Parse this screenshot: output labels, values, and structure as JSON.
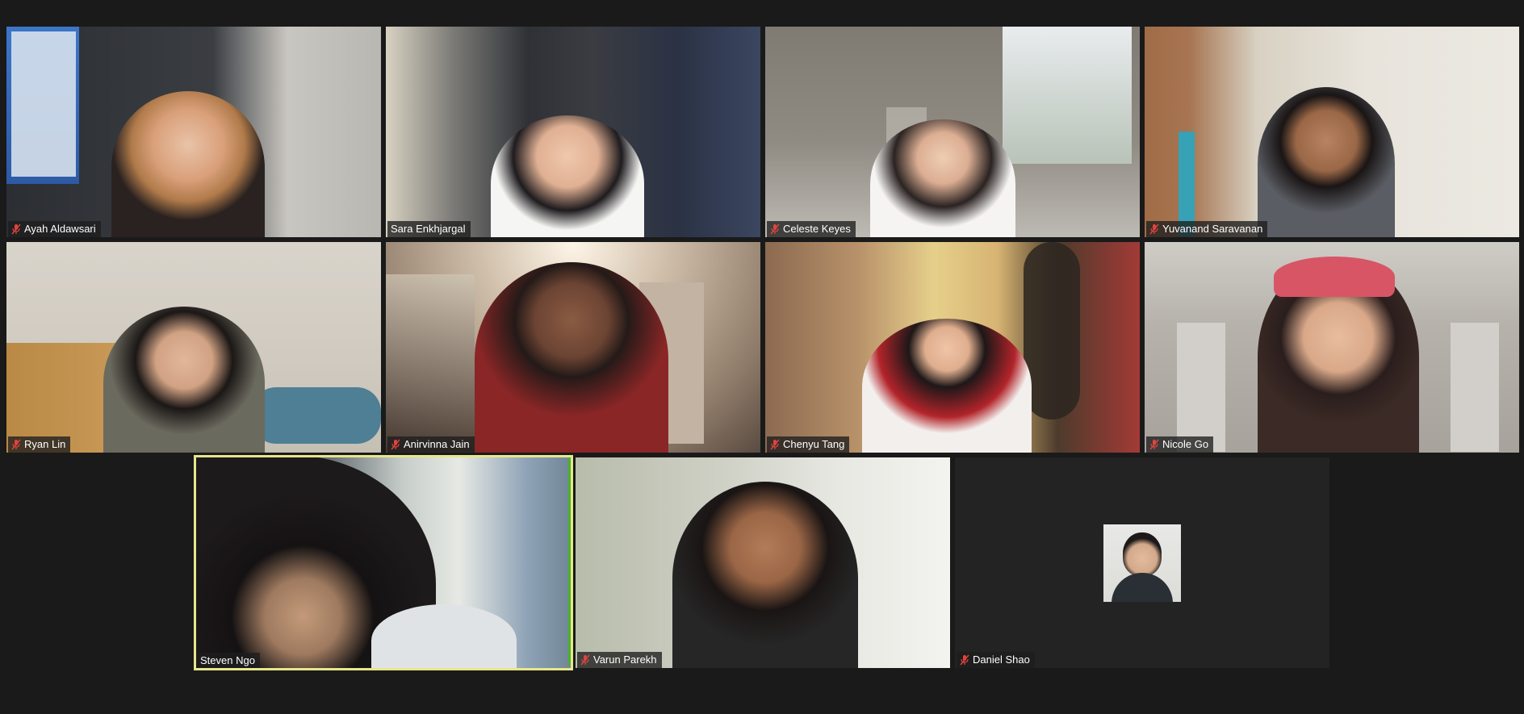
{
  "meeting": {
    "participants": [
      {
        "name": "Ayah Aldawsari",
        "muted": true
      },
      {
        "name": "Sara Enkhjargal",
        "muted": false
      },
      {
        "name": "Celeste Keyes",
        "muted": true
      },
      {
        "name": "Yuvanand Saravanan",
        "muted": true
      },
      {
        "name": "Ryan Lin",
        "muted": true
      },
      {
        "name": "Anirvinna Jain",
        "muted": true
      },
      {
        "name": "Chenyu Tang",
        "muted": true
      },
      {
        "name": "Nicole Go",
        "muted": true
      },
      {
        "name": "Steven Ngo",
        "muted": false,
        "active_speaker": true
      },
      {
        "name": "Varun Parekh",
        "muted": true
      },
      {
        "name": "Daniel Shao",
        "muted": true,
        "video_off": true
      }
    ]
  },
  "colors": {
    "background": "#1a1a1a",
    "active_speaker_border": "#e7e68c",
    "muted_icon": "#e0443e"
  },
  "icons": {
    "muted": "microphone-muted-icon"
  }
}
